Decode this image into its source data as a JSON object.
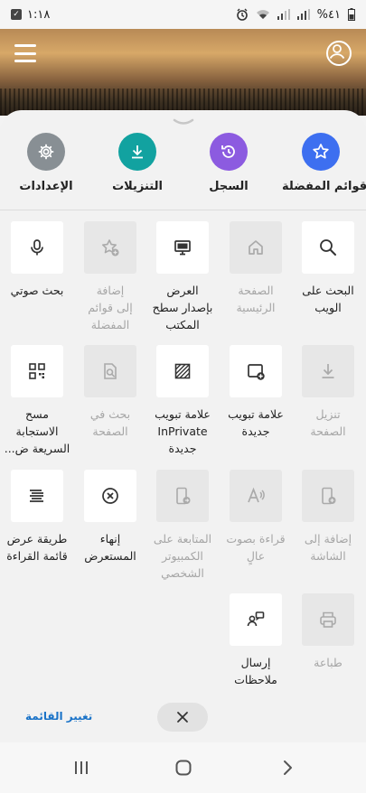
{
  "status_bar": {
    "time": "١:١٨",
    "battery": "%٤١"
  },
  "quick_actions": [
    {
      "key": "favorites",
      "label": "قوائم المفضلة",
      "icon": "star-icon",
      "color": "#3d6ff0"
    },
    {
      "key": "history",
      "label": "السجل",
      "icon": "history-icon",
      "color": "#8c5be0"
    },
    {
      "key": "downloads",
      "label": "التنزيلات",
      "icon": "download-icon",
      "color": "#12a2a0"
    },
    {
      "key": "settings",
      "label": "الإعدادات",
      "icon": "gear-icon",
      "color": "#888f94"
    }
  ],
  "tiles": [
    {
      "key": "web-search",
      "lines": [
        "البحث على",
        "الويب"
      ],
      "icon": "search-icon",
      "enabled": true
    },
    {
      "key": "home",
      "lines": [
        "الصفحة",
        "الرئيسية"
      ],
      "icon": "home-icon",
      "enabled": false
    },
    {
      "key": "desktop-site",
      "lines": [
        "العرض",
        "بإصدار سطح",
        "المكتب"
      ],
      "icon": "monitor-icon",
      "enabled": true
    },
    {
      "key": "add-favorites",
      "lines": [
        "إضافة",
        "إلى قوائم",
        "المفضلة"
      ],
      "icon": "star-plus-icon",
      "enabled": false
    },
    {
      "key": "voice-search",
      "lines": [
        "بحث صوتي"
      ],
      "icon": "microphone-icon",
      "enabled": true
    },
    {
      "key": "download-page",
      "lines": [
        "تنزيل",
        "الصفحة"
      ],
      "icon": "download-icon",
      "enabled": false
    },
    {
      "key": "new-tab",
      "lines": [
        "علامة تبويب",
        "جديدة"
      ],
      "icon": "new-tab-icon",
      "enabled": true
    },
    {
      "key": "new-inprivate-tab",
      "lines": [
        "علامة تبويب",
        "InPrivate",
        "جديدة"
      ],
      "icon": "inprivate-icon",
      "enabled": true
    },
    {
      "key": "find-in-page",
      "lines": [
        "بحث في",
        "الصفحة"
      ],
      "icon": "find-in-page-icon",
      "enabled": false
    },
    {
      "key": "qr-scan",
      "lines": [
        "مسح",
        "الاستجابة",
        "السريعة ض..."
      ],
      "icon": "qr-code-icon",
      "enabled": true
    },
    {
      "key": "add-to-screen",
      "lines": [
        "إضافة إلى",
        "الشاشة"
      ],
      "icon": "phone-add-icon",
      "enabled": false
    },
    {
      "key": "read-aloud",
      "lines": [
        "قراءة بصوت",
        "عالٍ"
      ],
      "icon": "read-aloud-icon",
      "enabled": false
    },
    {
      "key": "continue-on-pc",
      "lines": [
        "المتابعة على",
        "الكمبيوتر",
        "الشخصي"
      ],
      "icon": "continue-pc-icon",
      "enabled": false
    },
    {
      "key": "exit-browser",
      "lines": [
        "إنهاء",
        "المستعرض"
      ],
      "icon": "close-circle-icon",
      "enabled": true
    },
    {
      "key": "reading-view",
      "lines": [
        "طريقة عرض",
        "قائمة القراءة"
      ],
      "icon": "reading-list-icon",
      "enabled": true
    },
    {
      "key": "print",
      "lines": [
        "طباعة"
      ],
      "icon": "printer-icon",
      "enabled": false
    },
    {
      "key": "send-feedback",
      "lines": [
        "إرسال",
        "ملاحظات"
      ],
      "icon": "feedback-icon",
      "enabled": true
    }
  ],
  "footer": {
    "change_menu": "تغيير القائمة"
  }
}
